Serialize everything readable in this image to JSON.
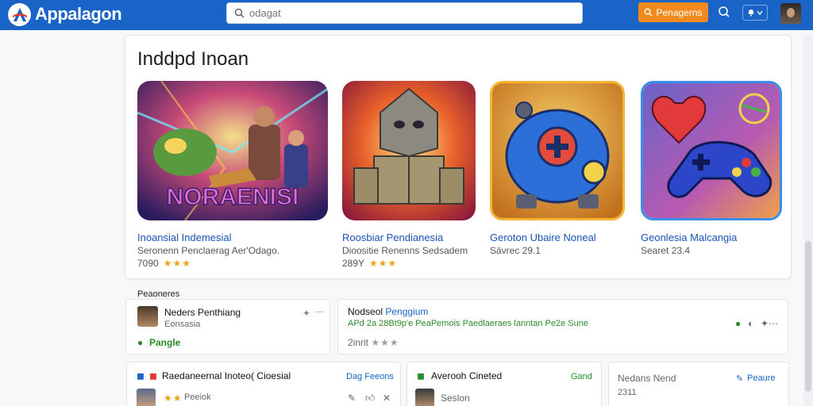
{
  "header": {
    "logo_text": "Appalagon",
    "search_placeholder": "odagat",
    "cta_label": "Penagerns"
  },
  "featured": {
    "title": "Inddpd Inoan",
    "tiles": [
      {
        "art_text": "NORAENISI",
        "name": "Inoansial Indemesial",
        "sub": "Seronenn Penclaerag Aer'Odago.",
        "count": "7090",
        "stars": 3
      },
      {
        "name": "Roosbiar Pendianesia",
        "sub": "Dioositie Renenns Sedsadem",
        "count": "289Y",
        "stars": 3
      },
      {
        "name": "Geroton Ubaire Noneal",
        "sub": "Sävrec 29.1"
      },
      {
        "name": "Geonlesia Malcangia",
        "sub": "Searet 23.4"
      }
    ]
  },
  "section": {
    "title": "Peaoneres",
    "card1": {
      "name": "Neders Penthiang",
      "sub": "Eonsasia",
      "tag": "Pangle"
    },
    "card2": {
      "title": "Nodseol",
      "title_accent": "Penggium",
      "line": "APd 2a 28Bt9p'e PeaPemois Paedlaeraes lanntan Pe2e Sune",
      "meta": "2inrit"
    },
    "card3": {
      "name": "Raedaneernal Inoteo( Cioesial",
      "action": "Dag Feeons",
      "sub": "Peeiok"
    },
    "card4": {
      "name": "Averooh Cineted",
      "action": "Gand",
      "sub": "Seslon"
    },
    "card5": {
      "name": "Nedans Nend",
      "sub": "2311",
      "action": "Peaure"
    }
  }
}
